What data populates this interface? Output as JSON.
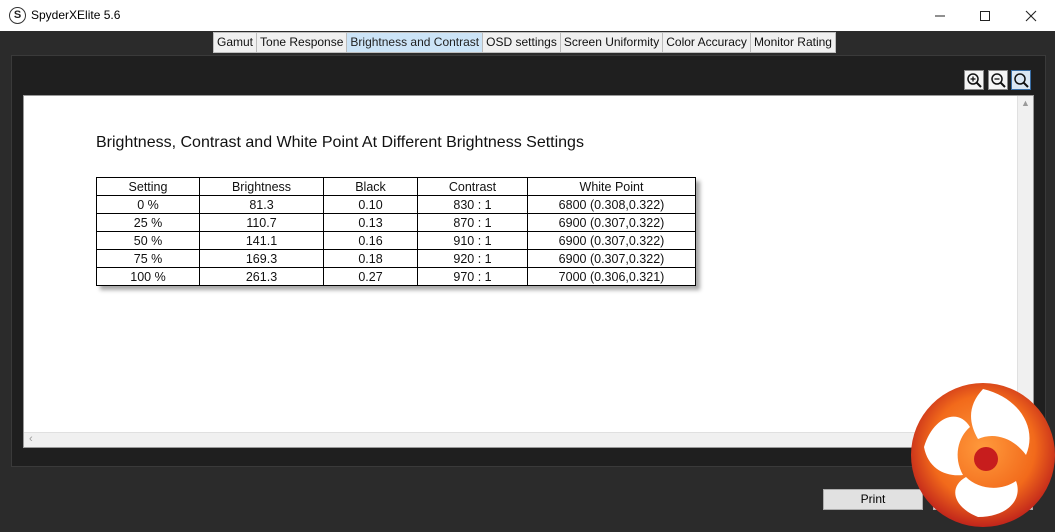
{
  "window": {
    "icon_letter": "S",
    "title": "SpyderXElite 5.6"
  },
  "tabs": [
    {
      "label": "Gamut"
    },
    {
      "label": "Tone Response"
    },
    {
      "label": "Brightness and Contrast",
      "active": true
    },
    {
      "label": "OSD settings"
    },
    {
      "label": "Screen Uniformity"
    },
    {
      "label": "Color Accuracy"
    },
    {
      "label": "Monitor Rating"
    }
  ],
  "report": {
    "title": "Brightness, Contrast and White Point At Different Brightness Settings",
    "columns": [
      "Setting",
      "Brightness",
      "Black",
      "Contrast",
      "White Point"
    ],
    "rows": [
      [
        "0 %",
        "81.3",
        "0.10",
        "830 : 1",
        "6800 (0.308,0.322)"
      ],
      [
        "25 %",
        "110.7",
        "0.13",
        "870 : 1",
        "6900 (0.307,0.322)"
      ],
      [
        "50 %",
        "141.1",
        "0.16",
        "910 : 1",
        "6900 (0.307,0.322)"
      ],
      [
        "75 %",
        "169.3",
        "0.18",
        "920 : 1",
        "6900 (0.307,0.322)"
      ],
      [
        "100 %",
        "261.3",
        "0.27",
        "970 : 1",
        "7000 (0.306,0.321)"
      ]
    ]
  },
  "buttons": {
    "print": "Print"
  },
  "icons": {
    "zoom_in": "zoom-in-icon",
    "zoom_out": "zoom-out-icon",
    "zoom_fit": "zoom-fit-icon"
  },
  "colors": {
    "active_tab": "#cce4f7",
    "window_bg": "#2b2b2b",
    "logo_orange": "#f26a1b",
    "logo_red": "#b3121b"
  }
}
